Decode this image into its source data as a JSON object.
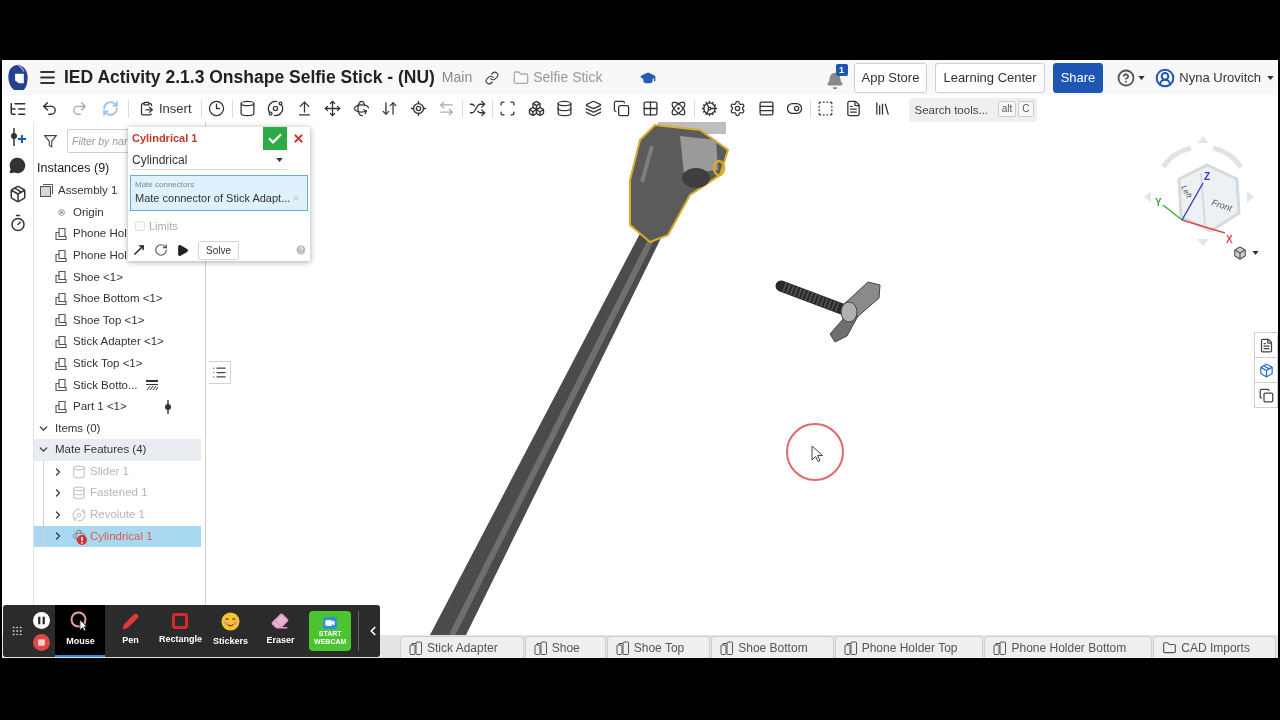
{
  "header": {
    "title": "IED Activity 2.1.3 Onshape Selfie Stick - (NU)",
    "branch": "Main",
    "folder": "Selfie Stick",
    "notification_count": "1",
    "buttons": [
      {
        "label": "App Store",
        "kind": "outline"
      },
      {
        "label": "Learning Center",
        "kind": "outline"
      },
      {
        "label": "Share",
        "kind": "primary"
      }
    ],
    "user": "Nyna Urovitch"
  },
  "toolbar": {
    "insert": "Insert",
    "search": {
      "placeholder": "Search tools...",
      "shortcut": [
        "alt",
        "C"
      ]
    }
  },
  "instances_panel": {
    "filter": {
      "placeholder": "Filter by nar"
    },
    "heading": "Instances (9)",
    "assembly": {
      "name": "Assembly 1",
      "children": [
        {
          "name": "Origin",
          "kind": "origin",
          "fixed": false,
          "mate_connector": false
        },
        {
          "name": "Phone Hol",
          "kind": "part",
          "fixed": false,
          "mate_connector": false
        },
        {
          "name": "Phone Hol",
          "kind": "part",
          "fixed": false,
          "mate_connector": false
        },
        {
          "name": "Shoe <1>",
          "kind": "part",
          "fixed": false,
          "mate_connector": false
        },
        {
          "name": "Shoe Bottom <1>",
          "kind": "part",
          "fixed": false,
          "mate_connector": false
        },
        {
          "name": "Shoe Top <1>",
          "kind": "part",
          "fixed": false,
          "mate_connector": false
        },
        {
          "name": "Stick Adapter <1>",
          "kind": "part",
          "fixed": false,
          "mate_connector": false
        },
        {
          "name": "Stick Top <1>",
          "kind": "part",
          "fixed": false,
          "mate_connector": false
        },
        {
          "name": "Stick Botto...",
          "kind": "part",
          "fixed": true,
          "mate_connector": false
        },
        {
          "name": "Part 1 <1>",
          "kind": "part",
          "fixed": false,
          "mate_connector": true
        }
      ]
    },
    "groups": [
      {
        "label": "Items (0)",
        "expanded": true,
        "highlighted": false
      },
      {
        "label": "Mate Features (4)",
        "expanded": true,
        "highlighted": true,
        "children": [
          {
            "name": "Slider 1",
            "kind": "slider",
            "expanded": false,
            "disabled": true,
            "error": false,
            "selected": false
          },
          {
            "name": "Fastened 1",
            "kind": "fastened",
            "expanded": false,
            "disabled": true,
            "error": false,
            "selected": false
          },
          {
            "name": "Revolute 1",
            "kind": "revolute",
            "expanded": false,
            "disabled": true,
            "error": false,
            "selected": false
          },
          {
            "name": "Cylindrical 1",
            "kind": "cylindrical",
            "expanded": false,
            "disabled": false,
            "error": true,
            "selected": true
          }
        ]
      }
    ]
  },
  "mate_dialog": {
    "title": "Cylindrical 1",
    "mate_type": "Cylindrical",
    "connectors": {
      "label": "Mate connectors",
      "value": "Mate connector of Stick Adapt..."
    },
    "limits": {
      "label": "Limits",
      "checked": false,
      "disabled": true
    },
    "solve": "Solve"
  },
  "view_cube": {
    "faces": [
      "Left",
      "Front"
    ],
    "axes": [
      {
        "label": "X",
        "color": "#e0474c"
      },
      {
        "label": "Y",
        "color": "#3aa83a"
      },
      {
        "label": "Z",
        "color": "#3b3bc4"
      }
    ]
  },
  "tabs": [
    {
      "label": "Stick Adapter",
      "kind": "part_studio",
      "selected": false
    },
    {
      "label": "Shoe",
      "kind": "part_studio",
      "selected": false
    },
    {
      "label": "Shoe Top",
      "kind": "part_studio",
      "selected": false
    },
    {
      "label": "Shoe Bottom",
      "kind": "part_studio",
      "selected": false
    },
    {
      "label": "Phone Holder Top",
      "kind": "part_studio",
      "selected": false
    },
    {
      "label": "Phone Holder Bottom",
      "kind": "part_studio",
      "selected": false
    },
    {
      "label": "CAD Imports",
      "kind": "folder",
      "selected": false
    }
  ],
  "recorder": {
    "tools": [
      {
        "label": "Mouse",
        "kind": "mouse",
        "selected": true
      },
      {
        "label": "Pen",
        "kind": "pen",
        "selected": false
      },
      {
        "label": "Rectangle",
        "kind": "rectangle",
        "selected": false
      },
      {
        "label": "Stickers",
        "kind": "stickers",
        "selected": false
      },
      {
        "label": "Eraser",
        "kind": "eraser",
        "selected": false
      }
    ],
    "webcam": "START WEBCAM"
  }
}
